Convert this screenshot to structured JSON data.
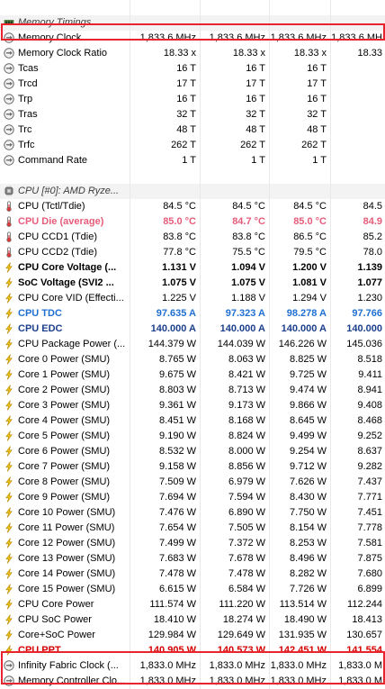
{
  "rows": [
    {
      "type": "empty"
    },
    {
      "type": "section",
      "icon": "memory-chip-icon",
      "label": "Memory Timings",
      "v": [
        "",
        "",
        "",
        ""
      ]
    },
    {
      "type": "data",
      "icon": "clock-icon",
      "label": "Memory Clock",
      "v": [
        "1,833.6 MHz",
        "1,833.6 MHz",
        "1,833.6 MHz",
        "1,833.6 MH"
      ]
    },
    {
      "type": "data",
      "icon": "clock-icon",
      "label": "Memory Clock Ratio",
      "v": [
        "18.33 x",
        "18.33 x",
        "18.33 x",
        "18.33"
      ]
    },
    {
      "type": "data",
      "icon": "clock-icon",
      "label": "Tcas",
      "v": [
        "16 T",
        "16 T",
        "16 T",
        ""
      ]
    },
    {
      "type": "data",
      "icon": "clock-icon",
      "label": "Trcd",
      "v": [
        "17 T",
        "17 T",
        "17 T",
        ""
      ]
    },
    {
      "type": "data",
      "icon": "clock-icon",
      "label": "Trp",
      "v": [
        "16 T",
        "16 T",
        "16 T",
        ""
      ]
    },
    {
      "type": "data",
      "icon": "clock-icon",
      "label": "Tras",
      "v": [
        "32 T",
        "32 T",
        "32 T",
        ""
      ]
    },
    {
      "type": "data",
      "icon": "clock-icon",
      "label": "Trc",
      "v": [
        "48 T",
        "48 T",
        "48 T",
        ""
      ]
    },
    {
      "type": "data",
      "icon": "clock-icon",
      "label": "Trfc",
      "v": [
        "262 T",
        "262 T",
        "262 T",
        ""
      ]
    },
    {
      "type": "data",
      "icon": "clock-icon",
      "label": "Command Rate",
      "v": [
        "1 T",
        "1 T",
        "1 T",
        ""
      ]
    },
    {
      "type": "empty"
    },
    {
      "type": "section",
      "icon": "cpu-chip-icon",
      "label": "CPU [#0]: AMD Ryze...",
      "v": [
        "",
        "",
        "",
        ""
      ]
    },
    {
      "type": "data",
      "icon": "thermometer-icon",
      "label": "CPU (Tctl/Tdie)",
      "v": [
        "84.5 °C",
        "84.5 °C",
        "84.5 °C",
        "84.5"
      ]
    },
    {
      "type": "data",
      "style": "pink",
      "icon": "thermometer-icon",
      "label": "CPU Die (average)",
      "v": [
        "85.0 °C",
        "84.7 °C",
        "85.0 °C",
        "84.9"
      ]
    },
    {
      "type": "data",
      "icon": "thermometer-icon",
      "label": "CPU CCD1 (Tdie)",
      "v": [
        "83.8 °C",
        "83.8 °C",
        "86.5 °C",
        "85.2"
      ]
    },
    {
      "type": "data",
      "icon": "thermometer-icon",
      "label": "CPU CCD2 (Tdie)",
      "v": [
        "77.8 °C",
        "75.5 °C",
        "79.5 °C",
        "78.0"
      ]
    },
    {
      "type": "data",
      "style": "bold",
      "icon": "lightning-icon",
      "label": "CPU Core Voltage (...",
      "v": [
        "1.131 V",
        "1.094 V",
        "1.200 V",
        "1.139"
      ]
    },
    {
      "type": "data",
      "style": "bold",
      "icon": "lightning-icon",
      "label": "SoC Voltage (SVI2 ...",
      "v": [
        "1.075 V",
        "1.075 V",
        "1.081 V",
        "1.077"
      ]
    },
    {
      "type": "data",
      "icon": "lightning-icon",
      "label": "CPU Core VID (Effecti...",
      "v": [
        "1.225 V",
        "1.188 V",
        "1.294 V",
        "1.230"
      ]
    },
    {
      "type": "data",
      "style": "blue",
      "icon": "lightning-icon",
      "label": "CPU TDC",
      "v": [
        "97.635 A",
        "97.323 A",
        "98.278 A",
        "97.766"
      ]
    },
    {
      "type": "data",
      "style": "navy",
      "icon": "lightning-icon",
      "label": "CPU EDC",
      "v": [
        "140.000 A",
        "140.000 A",
        "140.000 A",
        "140.000"
      ]
    },
    {
      "type": "data",
      "icon": "lightning-icon",
      "label": "CPU Package Power (...",
      "v": [
        "144.379 W",
        "144.039 W",
        "146.226 W",
        "145.036"
      ]
    },
    {
      "type": "data",
      "icon": "lightning-icon",
      "label": "Core 0 Power (SMU)",
      "v": [
        "8.765 W",
        "8.063 W",
        "8.825 W",
        "8.518"
      ]
    },
    {
      "type": "data",
      "icon": "lightning-icon",
      "label": "Core 1 Power (SMU)",
      "v": [
        "9.675 W",
        "8.421 W",
        "9.725 W",
        "9.411"
      ]
    },
    {
      "type": "data",
      "icon": "lightning-icon",
      "label": "Core 2 Power (SMU)",
      "v": [
        "8.803 W",
        "8.713 W",
        "9.474 W",
        "8.941"
      ]
    },
    {
      "type": "data",
      "icon": "lightning-icon",
      "label": "Core 3 Power (SMU)",
      "v": [
        "9.361 W",
        "9.173 W",
        "9.866 W",
        "9.408"
      ]
    },
    {
      "type": "data",
      "icon": "lightning-icon",
      "label": "Core 4 Power (SMU)",
      "v": [
        "8.451 W",
        "8.168 W",
        "8.645 W",
        "8.468"
      ]
    },
    {
      "type": "data",
      "icon": "lightning-icon",
      "label": "Core 5 Power (SMU)",
      "v": [
        "9.190 W",
        "8.824 W",
        "9.499 W",
        "9.252"
      ]
    },
    {
      "type": "data",
      "icon": "lightning-icon",
      "label": "Core 6 Power (SMU)",
      "v": [
        "8.532 W",
        "8.000 W",
        "9.254 W",
        "8.637"
      ]
    },
    {
      "type": "data",
      "icon": "lightning-icon",
      "label": "Core 7 Power (SMU)",
      "v": [
        "9.158 W",
        "8.856 W",
        "9.712 W",
        "9.282"
      ]
    },
    {
      "type": "data",
      "icon": "lightning-icon",
      "label": "Core 8 Power (SMU)",
      "v": [
        "7.509 W",
        "6.979 W",
        "7.626 W",
        "7.437"
      ]
    },
    {
      "type": "data",
      "icon": "lightning-icon",
      "label": "Core 9 Power (SMU)",
      "v": [
        "7.694 W",
        "7.594 W",
        "8.430 W",
        "7.771"
      ]
    },
    {
      "type": "data",
      "icon": "lightning-icon",
      "label": "Core 10 Power (SMU)",
      "v": [
        "7.476 W",
        "6.890 W",
        "7.750 W",
        "7.451"
      ]
    },
    {
      "type": "data",
      "icon": "lightning-icon",
      "label": "Core 11 Power (SMU)",
      "v": [
        "7.654 W",
        "7.505 W",
        "8.154 W",
        "7.778"
      ]
    },
    {
      "type": "data",
      "icon": "lightning-icon",
      "label": "Core 12 Power (SMU)",
      "v": [
        "7.499 W",
        "7.372 W",
        "8.253 W",
        "7.581"
      ]
    },
    {
      "type": "data",
      "icon": "lightning-icon",
      "label": "Core 13 Power (SMU)",
      "v": [
        "7.683 W",
        "7.678 W",
        "8.496 W",
        "7.875"
      ]
    },
    {
      "type": "data",
      "icon": "lightning-icon",
      "label": "Core 14 Power (SMU)",
      "v": [
        "7.478 W",
        "7.478 W",
        "8.282 W",
        "7.680"
      ]
    },
    {
      "type": "data",
      "icon": "lightning-icon",
      "label": "Core 15 Power (SMU)",
      "v": [
        "6.615 W",
        "6.584 W",
        "7.726 W",
        "6.899"
      ]
    },
    {
      "type": "data",
      "icon": "lightning-icon",
      "label": "CPU Core Power",
      "v": [
        "111.574 W",
        "111.220 W",
        "113.514 W",
        "112.244"
      ]
    },
    {
      "type": "data",
      "icon": "lightning-icon",
      "label": "CPU SoC Power",
      "v": [
        "18.410 W",
        "18.274 W",
        "18.490 W",
        "18.413"
      ]
    },
    {
      "type": "data",
      "icon": "lightning-icon",
      "label": "Core+SoC Power",
      "v": [
        "129.984 W",
        "129.649 W",
        "131.935 W",
        "130.657"
      ]
    },
    {
      "type": "data",
      "style": "red",
      "icon": "lightning-icon",
      "label": "CPU PPT",
      "v": [
        "140.905 W",
        "140.573 W",
        "142.451 W",
        "141.554"
      ]
    },
    {
      "type": "data",
      "icon": "clock-icon",
      "label": "Infinity Fabric Clock (...",
      "v": [
        "1,833.0 MHz",
        "1,833.0 MHz",
        "1,833.0 MHz",
        "1,833.0 M"
      ]
    },
    {
      "type": "data",
      "icon": "clock-icon",
      "label": "Memory Controller Clo...",
      "v": [
        "1,833.0 MHz",
        "1,833.0 MHz",
        "1,833.0 MHz",
        "1,833.0 M"
      ]
    }
  ],
  "colors": {
    "highlight_box": "#e8242c",
    "pink_text": "#e65c7a",
    "blue_text": "#1f6fd1",
    "navy_text": "#1c3f8c",
    "red_text": "#d40000"
  }
}
